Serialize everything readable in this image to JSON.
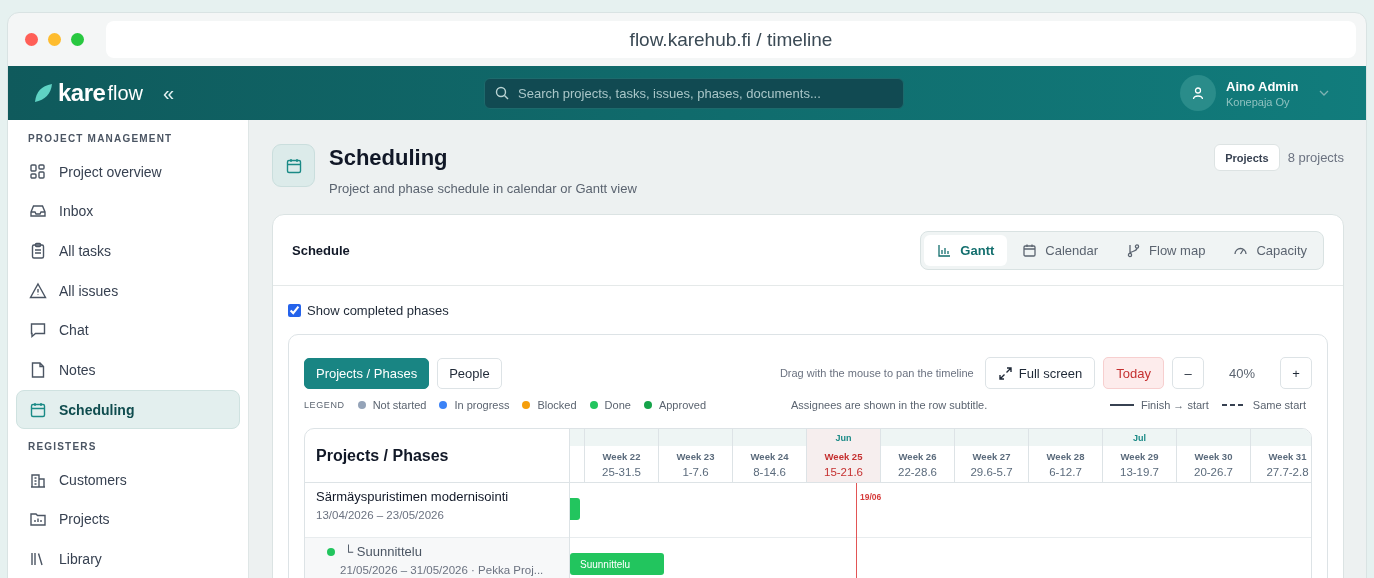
{
  "browser": {
    "url": "flow.karehub.fi / timeline"
  },
  "header": {
    "logo_main": "kare",
    "logo_sub": "flow",
    "collapse": "«",
    "search_placeholder": "Search projects, tasks, issues, phases, documents...",
    "user_name": "Aino Admin",
    "user_org": "Konepaja Oy"
  },
  "sidebar": [
    {
      "title": "PROJECT MANAGEMENT",
      "items": [
        {
          "label": "Project overview",
          "selected": false
        },
        {
          "label": "Inbox",
          "selected": false
        },
        {
          "label": "All tasks",
          "selected": false
        },
        {
          "label": "All issues",
          "selected": false
        },
        {
          "label": "Chat",
          "selected": false
        },
        {
          "label": "Notes",
          "selected": false
        },
        {
          "label": "Scheduling",
          "selected": true
        }
      ]
    },
    {
      "title": "REGISTERS",
      "items": [
        {
          "label": "Customers",
          "selected": false
        },
        {
          "label": "Projects",
          "selected": false
        },
        {
          "label": "Library",
          "selected": false
        }
      ]
    }
  ],
  "page": {
    "title": "Scheduling",
    "subtitle": "Project and phase schedule in calendar or Gantt view",
    "projects_button": "Projects",
    "count": "8 projects"
  },
  "card": {
    "title": "Schedule",
    "views": [
      {
        "label": "Gantt",
        "selected": true
      },
      {
        "label": "Calendar",
        "selected": false
      },
      {
        "label": "Flow map",
        "selected": false
      },
      {
        "label": "Capacity",
        "selected": false
      }
    ]
  },
  "show_completed": {
    "label": "Show completed phases",
    "checked": true
  },
  "toolbar": {
    "modes": [
      {
        "label": "Projects / Phases",
        "selected": true
      },
      {
        "label": "People",
        "selected": false
      }
    ],
    "hint": "Drag with the mouse to pan the timeline",
    "full_screen": "Full screen",
    "today": "Today",
    "zoom_out": "–",
    "zoom": "40%",
    "zoom_in": "+"
  },
  "legend": {
    "label": "LEGEND",
    "items": [
      {
        "label": "Not started",
        "color": "#94a3b8"
      },
      {
        "label": "In progress",
        "color": "#3b82f6"
      },
      {
        "label": "Blocked",
        "color": "#f59e0b"
      },
      {
        "label": "Done",
        "color": "#22c55e"
      },
      {
        "label": "Approved",
        "color": "#16a34a"
      }
    ],
    "note": "Assignees are shown in the row subtitle.",
    "lines": [
      {
        "label": "Finish → start",
        "kind": "solid"
      },
      {
        "label": "Same start",
        "kind": "dashed"
      }
    ]
  },
  "timeline": {
    "heading": "Projects / Phases",
    "today_marker": "19/06",
    "weeks": [
      {
        "week": "Week 22",
        "range": "25-31.5",
        "current": false
      },
      {
        "week": "Week 23",
        "range": "1-7.6",
        "current": false
      },
      {
        "week": "Week 24",
        "range": "8-14.6",
        "current": false
      },
      {
        "week": "Week 25",
        "range": "15-21.6",
        "current": true,
        "month": "Jun"
      },
      {
        "week": "Week 26",
        "range": "22-28.6",
        "current": false
      },
      {
        "week": "Week 27",
        "range": "29.6-5.7",
        "current": false
      },
      {
        "week": "Week 28",
        "range": "6-12.7",
        "current": false
      },
      {
        "week": "Week 29",
        "range": "13-19.7",
        "current": false,
        "month": "Jul"
      },
      {
        "week": "Week 30",
        "range": "20-26.7",
        "current": false
      },
      {
        "week": "Week 31",
        "range": "27.7-2.8",
        "current": false
      }
    ],
    "rows": [
      {
        "kind": "project",
        "title": "Särmäyspuristimen modernisointi",
        "subtitle": "13/04/2026 – 23/05/2026",
        "color": "#22c55e"
      },
      {
        "kind": "phase",
        "title": "└ Suunnittelu",
        "subtitle": "21/05/2026 – 31/05/2026 · Pekka Proj...",
        "color": "#22c55e",
        "bar_label": "Suunnittelu"
      }
    ]
  }
}
